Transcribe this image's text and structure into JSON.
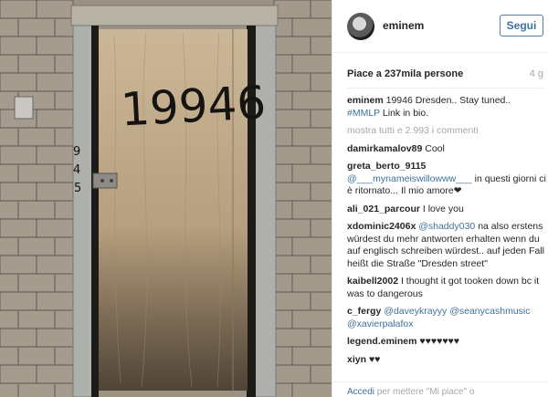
{
  "post": {
    "username": "eminem",
    "follow_label": "Segui",
    "likes": "Piace a 237mila persone",
    "age": "4 g",
    "caption_user": "eminem",
    "caption_text": "19946 Dresden.. Stay tuned..",
    "caption_hashtag": "#MMLP",
    "caption_tail": "Link in bio.",
    "show_all": "mostra tutti e 2.993 i commenti",
    "door_number": "19946",
    "door_side_number": "945",
    "comments": [
      {
        "user": "damirkamalov89",
        "pre": "Cool",
        "mention": "",
        "post": ""
      },
      {
        "user": "greta_berto_9115",
        "pre": "",
        "mention": "@___mynameiswillowww___",
        "post": "in questi giorni ci è ritornato... Il mio amore❤"
      },
      {
        "user": "ali_021_parcour",
        "pre": "I love you",
        "mention": "",
        "post": ""
      },
      {
        "user": "xdominic2406x",
        "pre": "",
        "mention": "@shaddy030",
        "post": "na also erstens würdest du mehr antworten erhalten wenn du auf englisch schreiben würdest.. auf jeden Fall heißt die Straße \"Dresden street\""
      },
      {
        "user": "kaibell2002",
        "pre": "I thought it got tooken down bc it was to dangerous",
        "mention": "",
        "post": ""
      },
      {
        "user": "c_fergy",
        "pre": "",
        "mention": "@daveykrayyy @seanycashmusic @xavierpalafox",
        "post": ""
      },
      {
        "user": "legend.eminem",
        "pre": "♥♥♥♥♥♥♥",
        "mention": "",
        "post": ""
      },
      {
        "user": "xiyn",
        "pre": "♥♥",
        "mention": "",
        "post": ""
      }
    ],
    "footer_link": "Accedi",
    "footer_text": "per mettere \"Mi piace\" o"
  }
}
